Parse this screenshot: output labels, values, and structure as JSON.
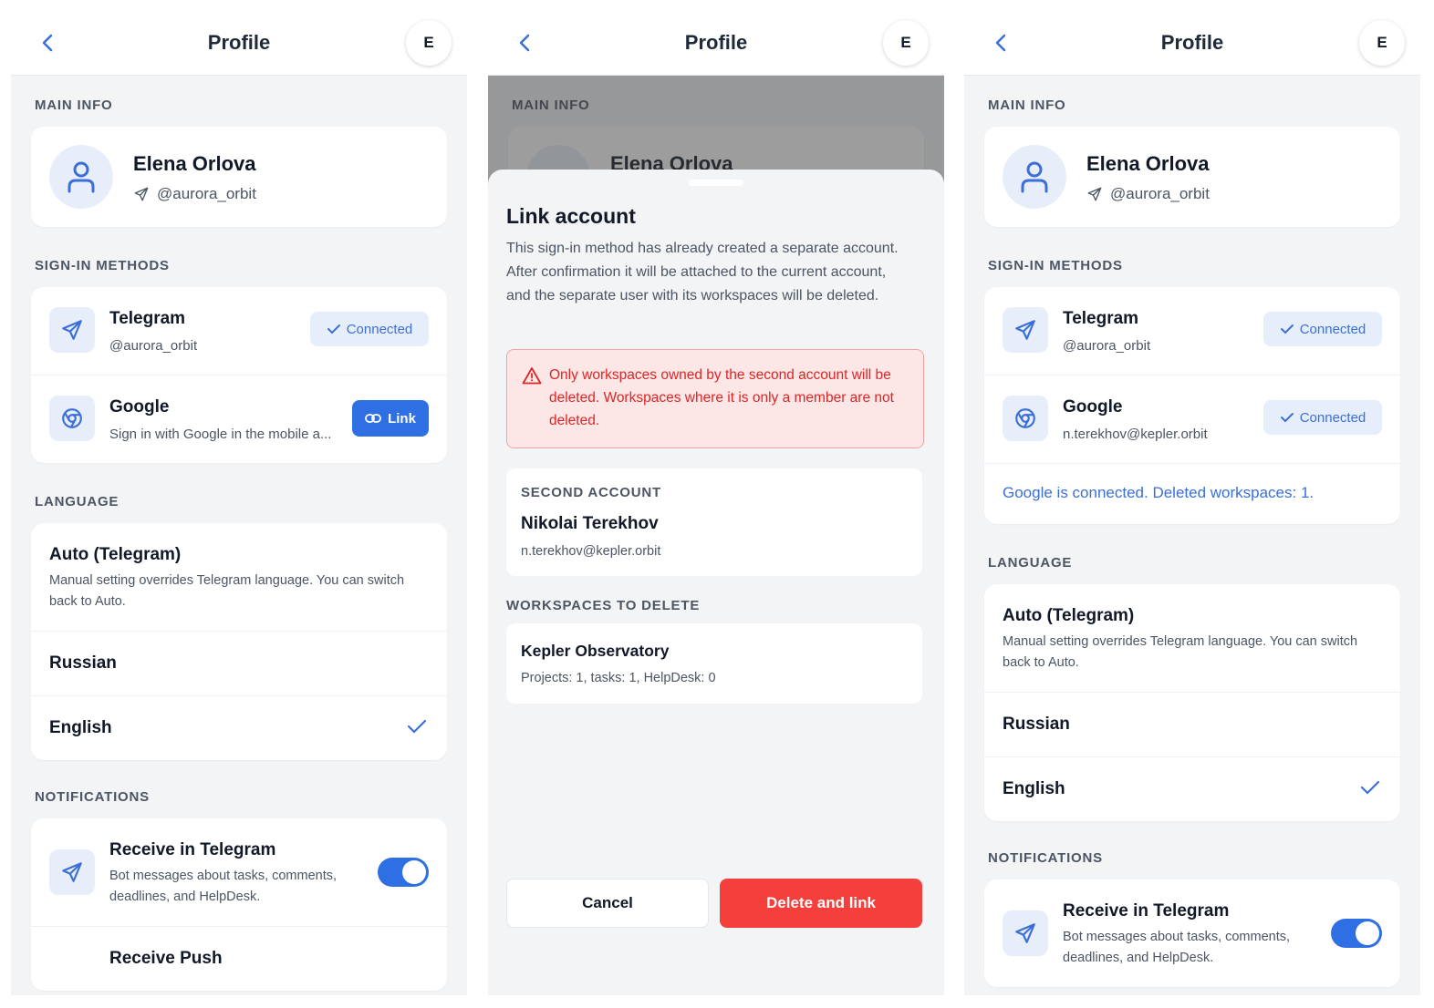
{
  "header": {
    "title": "Profile",
    "avatar_letter": "E"
  },
  "sections": {
    "main_info": "MAIN INFO",
    "sign_in": "SIGN-IN METHODS",
    "language": "LANGUAGE",
    "notifications": "NOTIFICATIONS"
  },
  "profile": {
    "name": "Elena Orlova",
    "handle": "@aurora_orbit"
  },
  "sign_in": {
    "telegram": {
      "name": "Telegram",
      "handle": "@aurora_orbit",
      "status": "Connected"
    },
    "google_unlinked": {
      "name": "Google",
      "subtitle": "Sign in with Google in the mobile a...",
      "button": "Link"
    },
    "google_linked": {
      "name": "Google",
      "email": "n.terekhov@kepler.orbit",
      "status": "Connected"
    },
    "info": "Google is connected. Deleted workspaces: 1."
  },
  "language": {
    "auto_title": "Auto (Telegram)",
    "auto_desc": "Manual setting overrides Telegram language. You can switch back to Auto.",
    "options": [
      "Russian",
      "English"
    ],
    "selected": "English"
  },
  "notifications": {
    "telegram_title": "Receive in Telegram",
    "telegram_desc": "Bot messages about tasks, comments, deadlines, and HelpDesk.",
    "telegram_enabled": true,
    "push_title": "Receive Push"
  },
  "modal": {
    "title": "Link account",
    "description": "This sign-in method has already created a separate account. After confirmation it will be attached to the current account, and the separate user with its workspaces will be deleted.",
    "warning": "Only workspaces owned by the second account will be deleted. Workspaces where it is only a member are not deleted.",
    "second_account_caption": "SECOND ACCOUNT",
    "second_account_name": "Nikolai Terekhov",
    "second_account_email": "n.terekhov@kepler.orbit",
    "workspaces_caption": "WORKSPACES TO DELETE",
    "workspace_name": "Kepler Observatory",
    "workspace_stats": "Projects: 1, tasks: 1, HelpDesk: 0",
    "cancel": "Cancel",
    "confirm": "Delete and link"
  },
  "colors": {
    "accent": "#2f6fe4",
    "danger": "#f43f3a",
    "background": "#f3f4f6"
  }
}
